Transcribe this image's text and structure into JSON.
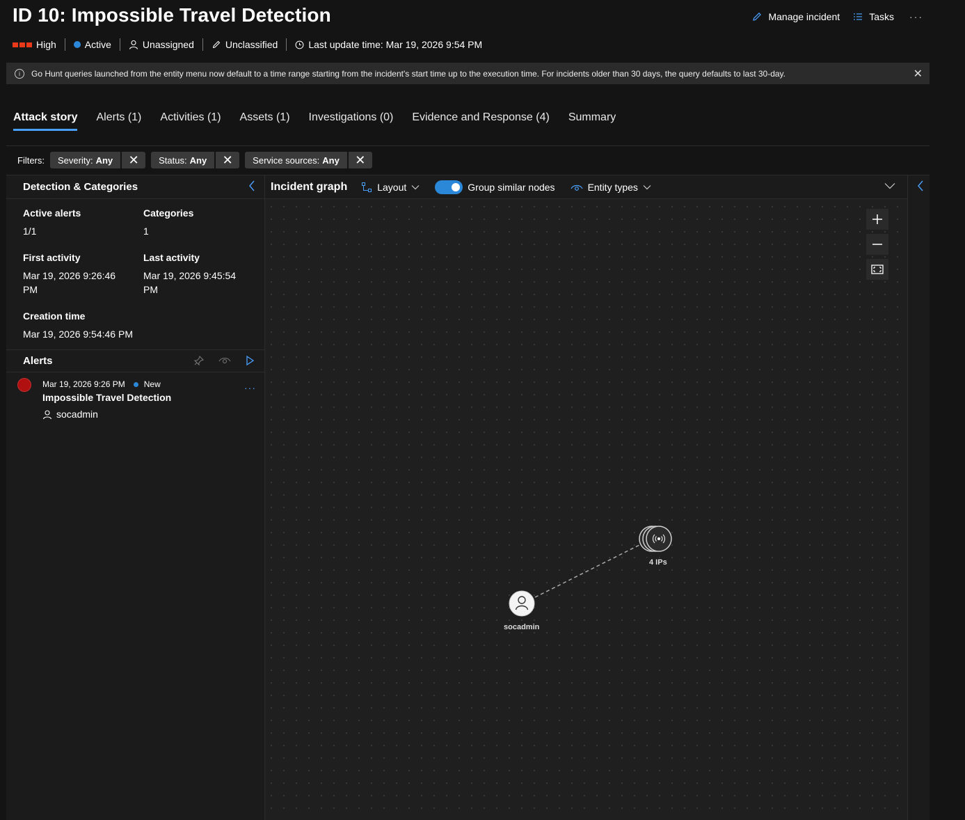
{
  "header": {
    "title": "ID 10: Impossible Travel Detection",
    "actions": {
      "manage": "Manage incident",
      "tasks": "Tasks",
      "more": "···"
    }
  },
  "meta": {
    "severity": "High",
    "status": "Active",
    "assigned": "Unassigned",
    "classification": "Unclassified",
    "last_update": "Last update time: Mar 19, 2026 9:54 PM"
  },
  "banner": {
    "text": "Go Hunt queries launched from the entity menu now default to a time range starting from the incident's start time up to the execution time. For incidents older than 30 days, the query defaults to last 30-day.",
    "close": "✕"
  },
  "tabs": [
    {
      "label": "Attack story"
    },
    {
      "label": "Alerts (1)"
    },
    {
      "label": "Activities (1)"
    },
    {
      "label": "Assets (1)"
    },
    {
      "label": "Investigations (0)"
    },
    {
      "label": "Evidence and Response (4)"
    },
    {
      "label": "Summary"
    }
  ],
  "filters": {
    "label": "Filters:",
    "chips": [
      {
        "key": "Severity:",
        "value": "Any"
      },
      {
        "key": "Status:",
        "value": "Any"
      },
      {
        "key": "Service sources:",
        "value": "Any"
      }
    ]
  },
  "detection": {
    "title": "Detection & Categories",
    "active_alerts_label": "Active alerts",
    "active_alerts": "1/1",
    "categories_label": "Categories",
    "categories": "1",
    "first_activity_label": "First activity",
    "first_activity": "Mar 19, 2026 9:26:46 PM",
    "last_activity_label": "Last activity",
    "last_activity": "Mar 19, 2026 9:45:54 PM",
    "creation_label": "Creation time",
    "creation": "Mar 19, 2026 9:54:46 PM"
  },
  "alerts": {
    "title": "Alerts",
    "items": [
      {
        "time": "Mar 19, 2026 9:26 PM",
        "status": "New",
        "name": "Impossible Travel Detection",
        "user": "socadmin"
      }
    ]
  },
  "graph": {
    "title": "Incident graph",
    "layout": "Layout",
    "group": "Group similar nodes",
    "group_on": true,
    "entity_types": "Entity types",
    "nodes": {
      "ips": "4 IPs",
      "user": "socadmin"
    }
  },
  "colors": {
    "accent": "#4aa0ff",
    "severity": "#e8391b",
    "status": "#2b88d8"
  }
}
